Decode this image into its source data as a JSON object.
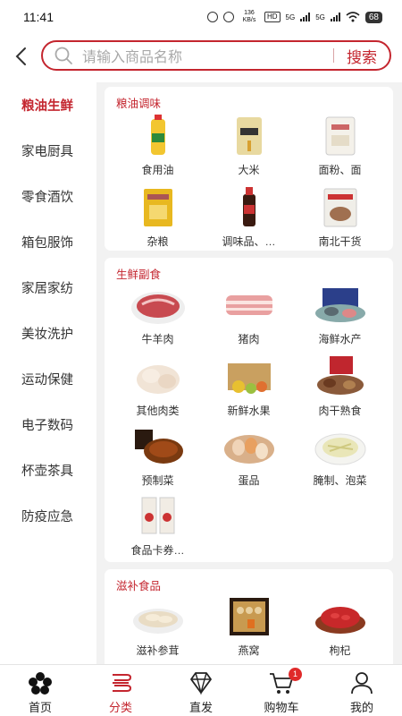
{
  "status": {
    "time": "11:41",
    "net_speed": "136 KB/s",
    "hd": "HD",
    "sig1": "5G",
    "sig2": "5G",
    "battery": "68"
  },
  "search": {
    "placeholder": "请输入商品名称",
    "button": "搜索"
  },
  "sidebar": {
    "items": [
      {
        "label": "粮油生鲜"
      },
      {
        "label": "家电厨具"
      },
      {
        "label": "零食酒饮"
      },
      {
        "label": "箱包服饰"
      },
      {
        "label": "家居家纺"
      },
      {
        "label": "美妆洗护"
      },
      {
        "label": "运动保健"
      },
      {
        "label": "电子数码"
      },
      {
        "label": "杯壶茶具"
      },
      {
        "label": "防疫应急"
      }
    ]
  },
  "sections": [
    {
      "title": "粮油调味",
      "items": [
        {
          "label": "食用油",
          "icon": "oil-bottle"
        },
        {
          "label": "大米",
          "icon": "rice-bag"
        },
        {
          "label": "面粉、面",
          "icon": "flour-bag"
        },
        {
          "label": "杂粮",
          "icon": "grain-bag"
        },
        {
          "label": "调味品、…",
          "icon": "soy-sauce"
        },
        {
          "label": "南北干货",
          "icon": "dried-goods"
        }
      ]
    },
    {
      "title": "生鲜副食",
      "items": [
        {
          "label": "牛羊肉",
          "icon": "beef-plate"
        },
        {
          "label": "猪肉",
          "icon": "pork"
        },
        {
          "label": "海鲜水产",
          "icon": "seafood"
        },
        {
          "label": "其他肉类",
          "icon": "chicken"
        },
        {
          "label": "新鲜水果",
          "icon": "fruit-box"
        },
        {
          "label": "肉干熟食",
          "icon": "jerky"
        },
        {
          "label": "预制菜",
          "icon": "prepared-dish"
        },
        {
          "label": "蛋品",
          "icon": "eggs"
        },
        {
          "label": "腌制、泡菜",
          "icon": "pickles"
        },
        {
          "label": "食品卡券…",
          "icon": "food-voucher"
        }
      ]
    },
    {
      "title": "滋补食品",
      "items": [
        {
          "label": "滋补参茸",
          "icon": "ginseng"
        },
        {
          "label": "燕窝",
          "icon": "birds-nest"
        },
        {
          "label": "枸杞",
          "icon": "goji"
        }
      ]
    }
  ],
  "tabbar": [
    {
      "label": "首页",
      "icon": "home-icon"
    },
    {
      "label": "分类",
      "icon": "category-icon"
    },
    {
      "label": "直发",
      "icon": "diamond-icon"
    },
    {
      "label": "购物车",
      "icon": "cart-icon",
      "badge": "1"
    },
    {
      "label": "我的",
      "icon": "profile-icon"
    }
  ],
  "colors": {
    "accent": "#c4262f",
    "badge": "#e02a2a",
    "panel_bg": "#f2f2f2"
  }
}
